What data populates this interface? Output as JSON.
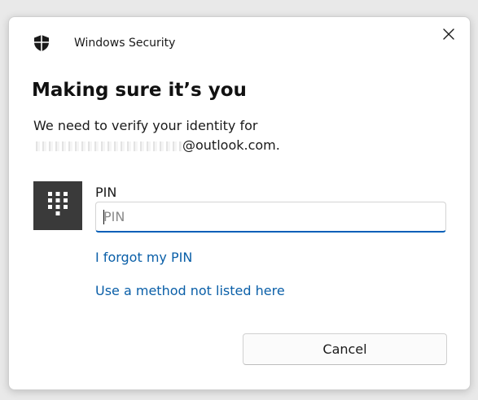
{
  "window": {
    "app_title": "Windows Security",
    "app_icon": "shield-icon",
    "close_icon": "close-icon"
  },
  "main": {
    "heading": "Making sure it’s you",
    "subtext_line1": "We need to verify your identity for",
    "email_suffix": "@outlook.com."
  },
  "pin": {
    "tile_icon": "keypad-icon",
    "label": "PIN",
    "placeholder": "PIN",
    "value": ""
  },
  "links": {
    "forgot_pin": "I forgot my PIN",
    "other_method": "Use a method not listed here"
  },
  "actions": {
    "cancel_label": "Cancel"
  },
  "colors": {
    "accent": "#005fb8",
    "link": "#0a5fa8",
    "tile": "#3a3a3a"
  }
}
